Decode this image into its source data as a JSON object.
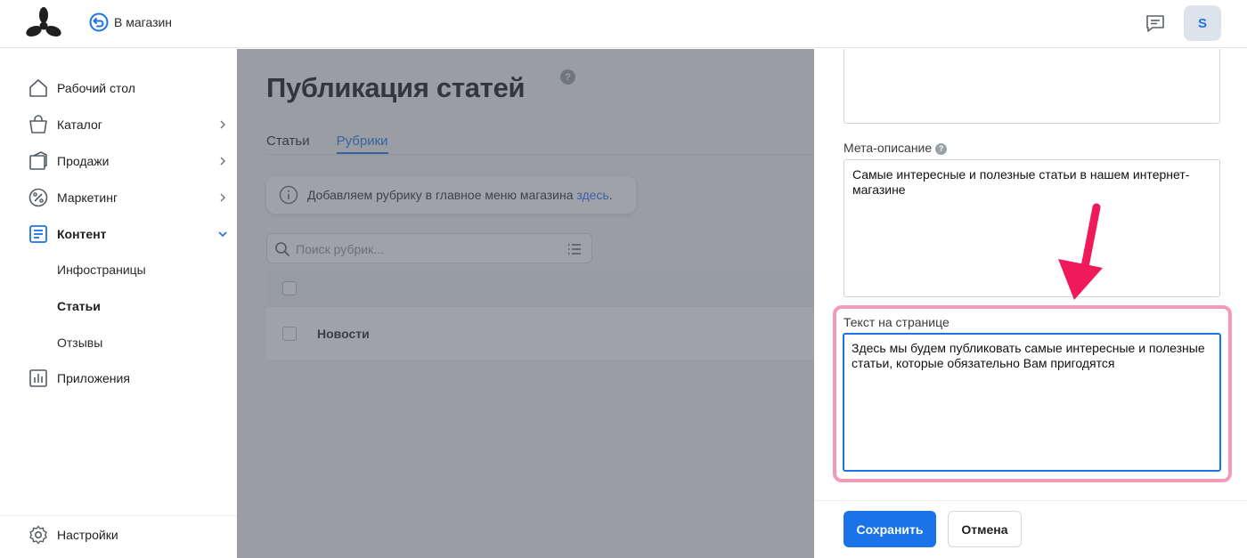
{
  "header": {
    "back_label": "В магазин",
    "avatar_letter": "S"
  },
  "sidebar": {
    "items": [
      {
        "label": "Рабочий стол",
        "icon": "home-icon"
      },
      {
        "label": "Каталог",
        "icon": "bag-icon",
        "has_arrow": true
      },
      {
        "label": "Продажи",
        "icon": "sales-icon",
        "has_arrow": true
      },
      {
        "label": "Маркетинг",
        "icon": "percent-icon",
        "has_arrow": true
      },
      {
        "label": "Контент",
        "icon": "content-icon",
        "expanded": true
      },
      {
        "label": "Приложения",
        "icon": "apps-icon"
      }
    ],
    "subitems": [
      "Инфостраницы",
      "Статьи",
      "Отзывы"
    ],
    "active_subitem": "Статьи",
    "settings_label": "Настройки"
  },
  "main": {
    "title": "Публикация статей",
    "help_glyph": "?",
    "tabs": [
      {
        "label": "Статьи",
        "active": false
      },
      {
        "label": "Рубрики",
        "active": true
      }
    ],
    "info_text": "Добавляем рубрику в главное меню магазина ",
    "info_link": "здесь",
    "info_suffix": ".",
    "search_placeholder": "Поиск рубрик...",
    "rows": [
      {
        "name": "Новости"
      }
    ]
  },
  "panel": {
    "top_field_value": "",
    "meta_label": "Мета-описание",
    "meta_value": "Самые интересные и полезные статьи в нашем интернет-магазине",
    "text_label": "Текст на странице",
    "text_value": "Здесь мы будем публиковать самые интересные и полезные статьи, которые обязательно Вам пригодятся",
    "save_label": "Сохранить",
    "cancel_label": "Отмена"
  },
  "colors": {
    "accent": "#1b73e8",
    "highlight_border": "#f49ab7",
    "annotation_arrow": "#f0195a",
    "dim_overlay": "rgba(80,86,96,0.55)"
  }
}
